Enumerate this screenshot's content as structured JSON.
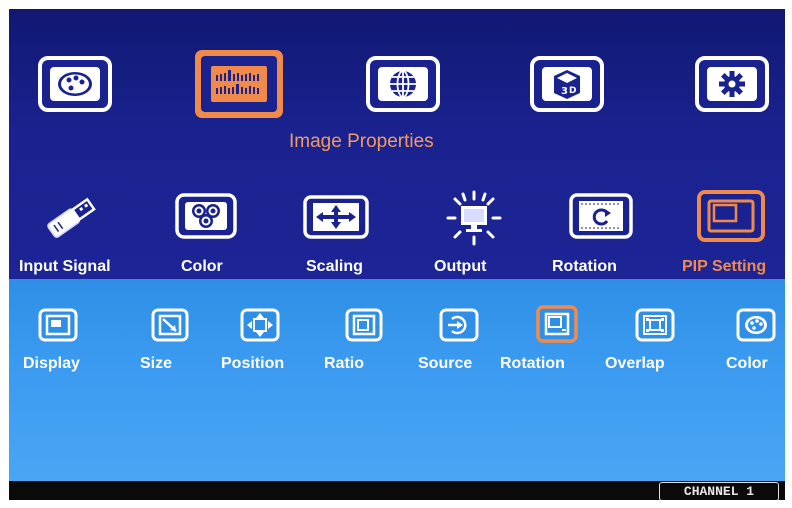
{
  "top_menu": {
    "title": "Image Properties",
    "items": [
      {
        "name": "palette-icon"
      },
      {
        "name": "image-properties-icon",
        "selected": true
      },
      {
        "name": "globe-icon"
      },
      {
        "name": "3d-icon"
      },
      {
        "name": "gear-icon"
      }
    ]
  },
  "sub_menu": {
    "items": [
      {
        "label": "Input Signal",
        "icon": "usb-plug-icon"
      },
      {
        "label": "Color",
        "icon": "color-dots-icon"
      },
      {
        "label": "Scaling",
        "icon": "scaling-arrows-icon"
      },
      {
        "label": "Output",
        "icon": "output-monitor-icon"
      },
      {
        "label": "Rotation",
        "icon": "rotation-icon"
      },
      {
        "label": "PIP Setting",
        "icon": "pip-icon",
        "selected": true
      }
    ]
  },
  "pip_menu": {
    "items": [
      {
        "label": "Display",
        "icon": "display-icon"
      },
      {
        "label": "Size",
        "icon": "size-icon"
      },
      {
        "label": "Position",
        "icon": "position-icon"
      },
      {
        "label": "Ratio",
        "icon": "ratio-icon"
      },
      {
        "label": "Source",
        "icon": "source-icon"
      },
      {
        "label": "Rotation",
        "icon": "pip-rotation-icon",
        "selected": true
      },
      {
        "label": "Overlap",
        "icon": "overlap-icon"
      },
      {
        "label": "Color",
        "icon": "pip-color-icon"
      }
    ]
  },
  "status": {
    "channel": "CHANNEL 1"
  },
  "colors": {
    "accent": "#f28b4a",
    "top_bg": "#1a228f",
    "bottom_bg": "#3a9af0"
  }
}
